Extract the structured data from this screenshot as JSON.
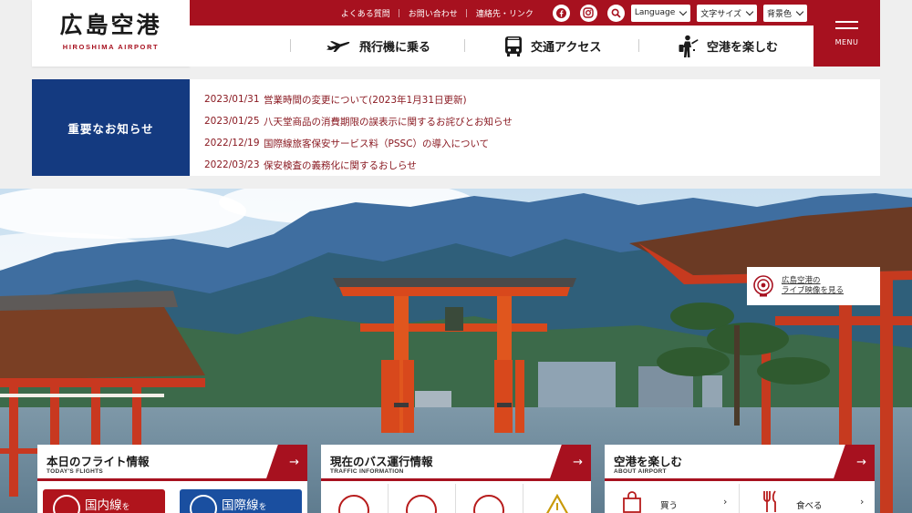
{
  "header": {
    "logo_jp": "広島空港",
    "logo_en": "HIROSHIMA AIRPORT",
    "top_links": [
      "よくある質問",
      "お問い合わせ",
      "連絡先・リンク"
    ],
    "social_icons": [
      "facebook-icon",
      "instagram-icon",
      "search-icon"
    ],
    "selects": {
      "language": "Language",
      "font_size": "文字サイズ",
      "background": "背景色"
    },
    "nav": [
      {
        "label": "飛行機に乗る",
        "icon": "airplane-icon"
      },
      {
        "label": "交通アクセス",
        "icon": "bus-icon"
      },
      {
        "label": "空港を楽しむ",
        "icon": "traveler-icon"
      }
    ],
    "menu_label": "MENU"
  },
  "notice": {
    "heading": "重要なお知らせ",
    "items": [
      {
        "date": "2023/01/31",
        "text": "営業時間の変更について(2023年1月31日更新)"
      },
      {
        "date": "2023/01/25",
        "text": "八天堂商品の消費期限の誤表示に関するお詫びとお知らせ"
      },
      {
        "date": "2022/12/19",
        "text": "国際線旅客保安サービス料（PSSC）の導入について"
      },
      {
        "date": "2022/03/23",
        "text": "保安検査の義務化に関するおしらせ"
      }
    ]
  },
  "live_camera": {
    "line1": "広島空港の",
    "line2": "ライブ映像を見る"
  },
  "cards": {
    "flights": {
      "title": "本日のフライト情報",
      "subtitle": "TODAY'S FLIGHTS",
      "domestic": "国内線",
      "domestic_suffix": "を",
      "international": "国際線",
      "international_suffix": "を"
    },
    "bus": {
      "title": "現在のバス運行情報",
      "subtitle": "TRAFFIC INFORMATION"
    },
    "about": {
      "title": "空港を楽しむ",
      "subtitle": "ABOUT AIRPORT",
      "items": [
        {
          "label": "買う",
          "icon": "shopping-bag-icon"
        },
        {
          "label": "食べる",
          "icon": "utensils-icon"
        }
      ]
    }
  },
  "colors": {
    "brand_red": "#a7111f",
    "notice_blue": "#143a80",
    "domestic_red": "#b0141c",
    "international_blue": "#1a4fa0"
  }
}
